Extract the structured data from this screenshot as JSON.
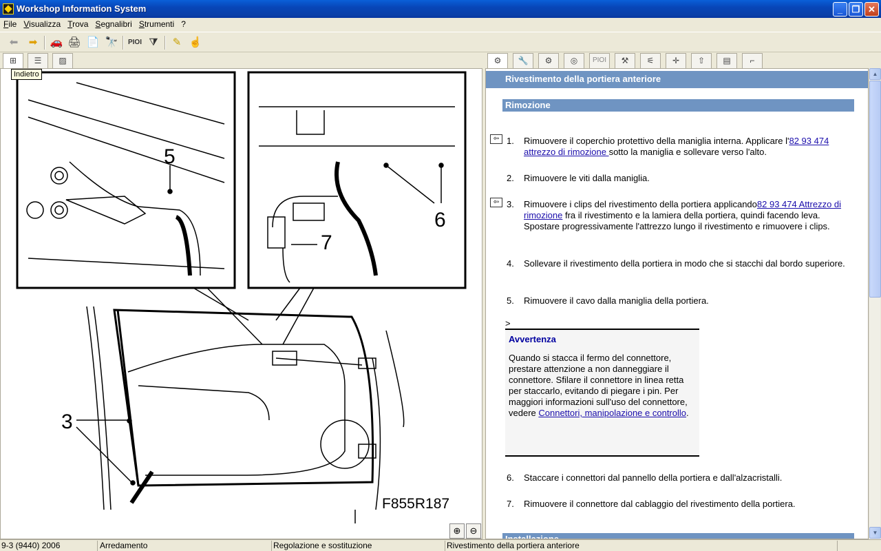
{
  "window": {
    "title": "Workshop Information System"
  },
  "menu": [
    "File",
    "Visualizza",
    "Trova",
    "Segnalibri",
    "Strumenti",
    "?"
  ],
  "toolbar": {
    "back": "back-arrow-icon",
    "forward": "forward-arrow-icon",
    "text_button": "PIOI"
  },
  "left_tabs": [
    "tree-view-icon",
    "list-view-icon",
    "image-view-icon"
  ],
  "right_tabs": [
    "engine-icon",
    "wrench-icon",
    "gears-icon",
    "brake-icon",
    "PIOI",
    "tools-icon",
    "bracket-icon",
    "crosshair-icon",
    "lift-icon",
    "diagnostic-icon",
    "seat-icon"
  ],
  "tooltip": "Indietro",
  "figure": {
    "label": "F855R187",
    "callouts": [
      "5",
      "6",
      "7",
      "3"
    ]
  },
  "doc": {
    "title": "Rivestimento della portiera anteriore",
    "section": "Rimozione",
    "steps": [
      {
        "num": "1.",
        "pre": "Rimuovere il coperchio protettivo della maniglia interna. Applicare l'",
        "link": "82 93 474 attrezzo di rimozione ",
        "post": "sotto la maniglia e sollevare verso l'alto."
      },
      {
        "num": "2.",
        "pre": "Rimuovere le viti dalla maniglia.",
        "link": "",
        "post": ""
      },
      {
        "num": "3.",
        "pre": "Rimuovere i clips del rivestimento della portiera applicando",
        "link": "82 93 474 Attrezzo di rimozione",
        "post": " fra il rivestimento e la lamiera della portiera, quindi facendo leva. Spostare progressivamente l'attrezzo lungo il rivestimento e rimuovere i clips."
      },
      {
        "num": "4.",
        "pre": "Sollevare il rivestimento della portiera in modo che si stacchi dal bordo superiore.",
        "link": "",
        "post": ""
      },
      {
        "num": "5.",
        "pre": "Rimuovere il cavo dalla maniglia della portiera.",
        "link": "",
        "post": ""
      },
      {
        "num": "6.",
        "pre": "Staccare i connettori dal pannello della portiera e dall'alzacristalli.",
        "link": "",
        "post": ""
      },
      {
        "num": "7.",
        "pre": "Rimuovere il connettore dal cablaggio del rivestimento della portiera.",
        "link": "",
        "post": ""
      }
    ],
    "caret": ">",
    "warning": {
      "title": "Avvertenza",
      "body": "Quando si stacca il fermo del connettore, prestare attenzione a non danneggiare il connettore. Sfilare il connettore in linea retta per staccarlo, evitando di piegare i pin. Per maggiori informazioni sull'uso del connettore, vedere ",
      "link": "Connettori, manipolazione e controllo",
      "end": "."
    },
    "next_section": "Installazione"
  },
  "status": [
    "9-3 (9440) 2006",
    "Arredamento",
    "Regolazione e sostituzione",
    "Rivestimento della portiera anteriore"
  ]
}
